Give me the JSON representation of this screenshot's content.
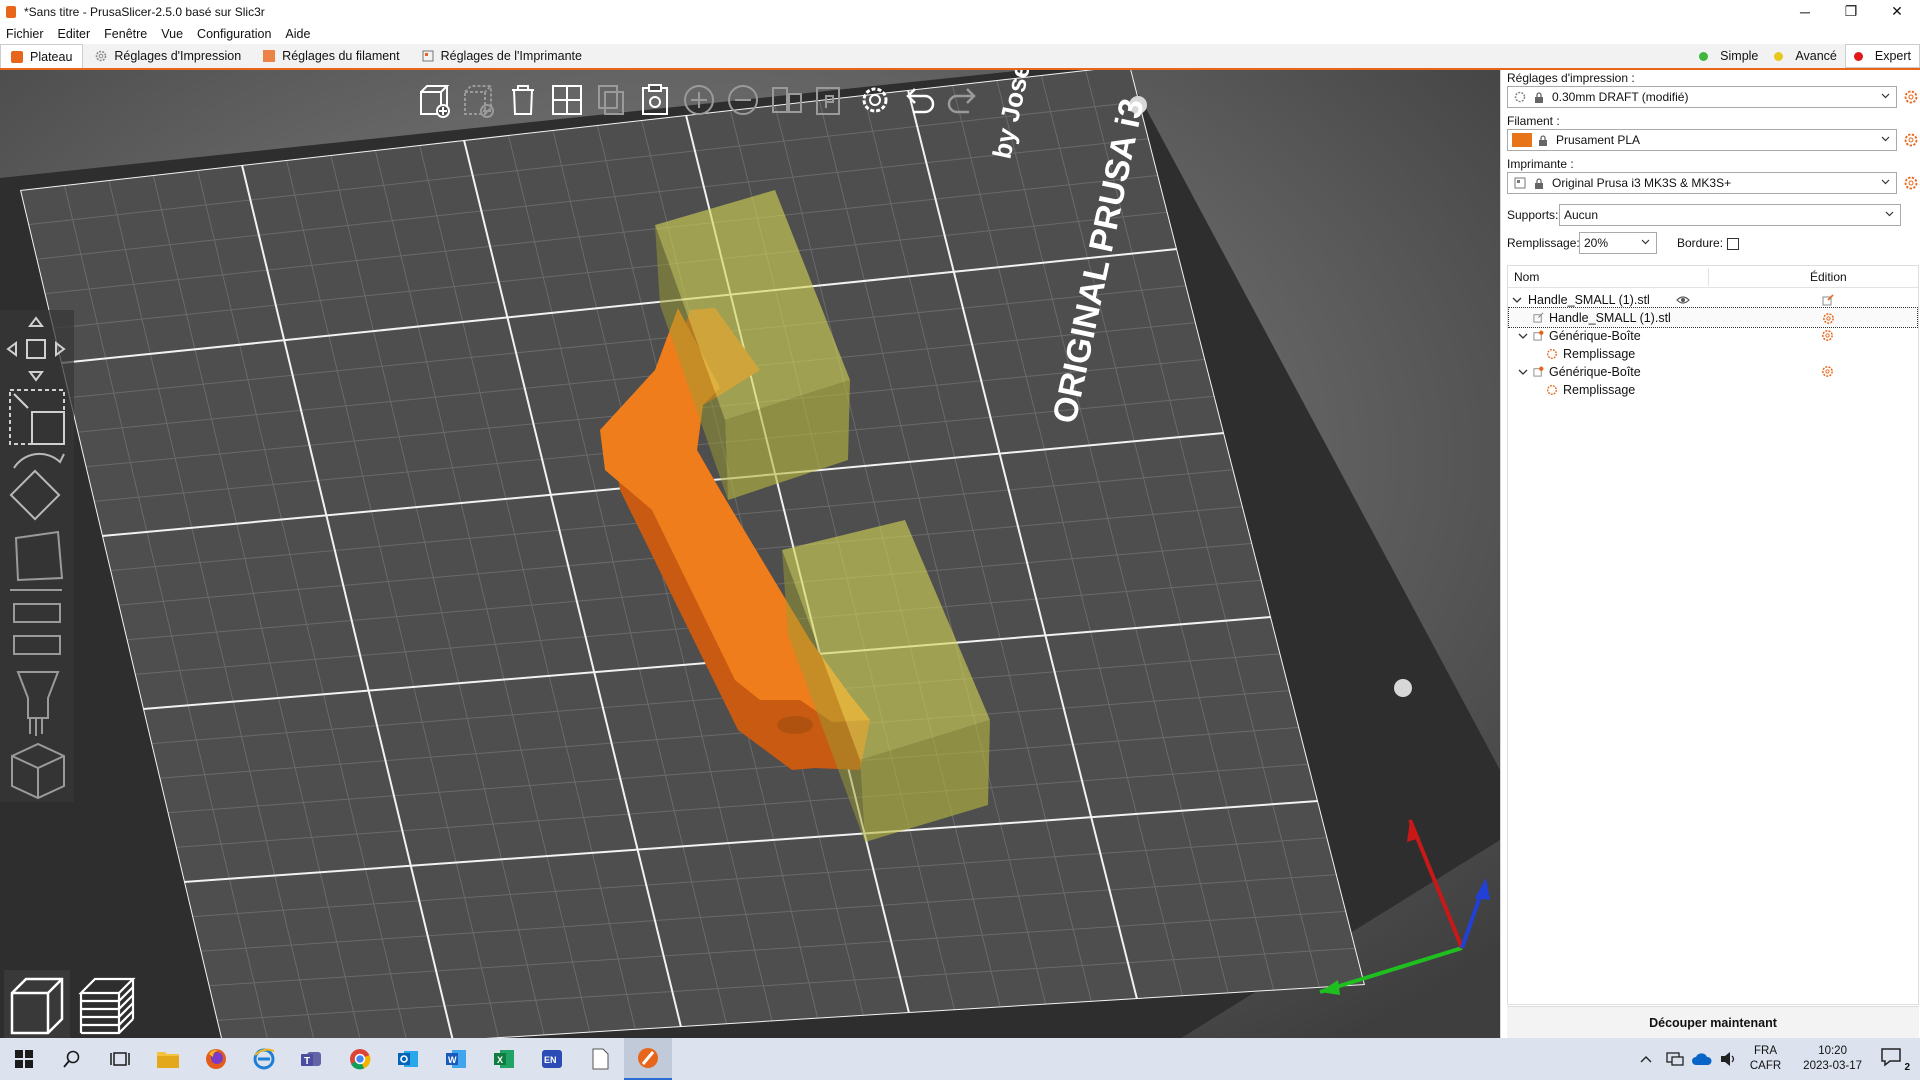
{
  "window": {
    "title": "*Sans titre - PrusaSlicer-2.5.0 basé sur Slic3r",
    "minimize": "─",
    "maximize": "❐",
    "close": "✕"
  },
  "menu": [
    "Fichier",
    "Editer",
    "Fenêtre",
    "Vue",
    "Configuration",
    "Aide"
  ],
  "tabs": [
    "Plateau",
    "Réglages d'Impression",
    "Réglages du filament",
    "Réglages de l'Imprimante"
  ],
  "modes": [
    {
      "label": "Simple",
      "color": "#3db83d"
    },
    {
      "label": "Avancé",
      "color": "#e6c81e"
    },
    {
      "label": "Expert",
      "color": "#e01818"
    }
  ],
  "bed": {
    "brand_line1": "ORIGINAL PRUSA i3",
    "brand_line2": "by Josef"
  },
  "colors": {
    "accent": "#e8661b",
    "model": "#e8741a",
    "modifier": "#d4d455",
    "bed": "#4e4e4e"
  },
  "panel": {
    "print_label": "Réglages d'impression :",
    "print_value": "0.30mm DRAFT (modifié)",
    "filament_label": "Filament :",
    "filament_value": "Prusament PLA",
    "printer_label": "Imprimante :",
    "printer_value": "Original Prusa i3 MK3S & MK3S+",
    "supports_label": "Supports:",
    "supports_value": "Aucun",
    "infill_label": "Remplissage:",
    "infill_value": "20%",
    "brim_label": "Bordure:"
  },
  "tree": {
    "col_name": "Nom",
    "col_edit": "Édition",
    "rows": [
      {
        "label": "Handle_SMALL (1).stl"
      },
      {
        "label": "Handle_SMALL (1).stl"
      },
      {
        "label": "Générique-Boîte"
      },
      {
        "label": "Remplissage"
      },
      {
        "label": "Générique-Boîte"
      },
      {
        "label": "Remplissage"
      }
    ]
  },
  "slice_button": "Découper maintenant",
  "taskbar": {
    "lang": "FRA",
    "layout": "CAFR",
    "time": "10:20",
    "date": "2023-03-17",
    "notif_count": "2"
  }
}
